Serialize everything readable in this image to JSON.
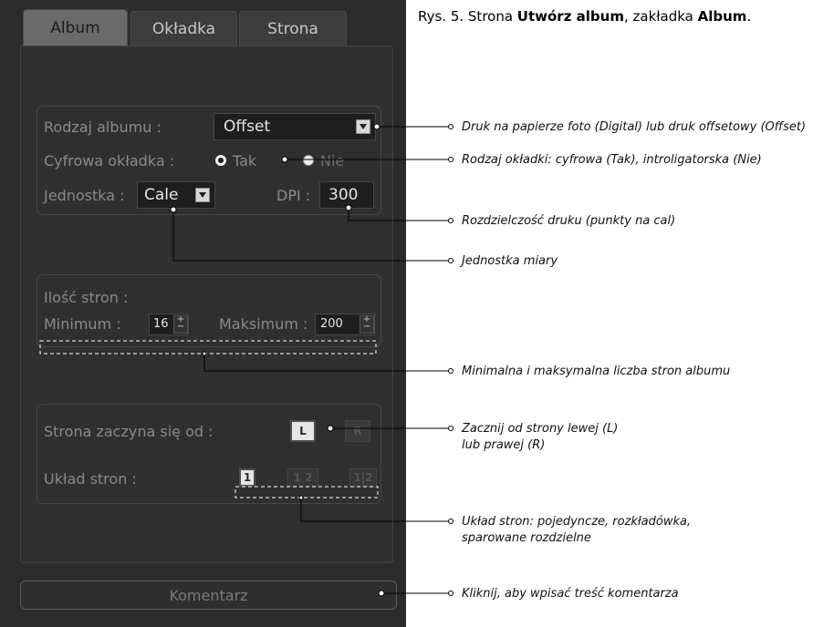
{
  "tabs": [
    {
      "label": "Album",
      "active": true
    },
    {
      "label": "Okładka",
      "active": false
    },
    {
      "label": "Strona",
      "active": false
    }
  ],
  "album_group": {
    "type_label": "Rodzaj albumu :",
    "type_value": "Offset",
    "cover_label": "Cyfrowa okładka :",
    "cover_options": [
      "Tak",
      "Nie"
    ],
    "cover_selected": "Tak",
    "unit_label": "Jednostka :",
    "unit_value": "Cale",
    "dpi_label": "DPI :",
    "dpi_value": "300"
  },
  "pages_group": {
    "title": "Ilość stron :",
    "min_label": "Minimum :",
    "min_value": "16",
    "max_label": "Maksimum :",
    "max_value": "200"
  },
  "layout_group": {
    "start_label": "Strona zaczyna się od :",
    "start_left": "L",
    "start_right": "R",
    "layout_label": "Układ stron :",
    "layout_single": "1",
    "layout_spread": "1 2",
    "layout_paired": "1|2"
  },
  "comment_button": "Komentarz",
  "caption": {
    "prefix": "Rys. 5. Strona ",
    "bold1": "Utwórz album",
    "mid": ", zakładka ",
    "bold2": "Album",
    "suffix": "."
  },
  "notes": {
    "album_type": "Druk na papierze foto (Digital) lub druk offsetowy (Offset)",
    "cover_type": "Rodzaj okładki: cyfrowa (Tak), introligatorska (Nie)",
    "resolution": "Rozdzielczość druku (punkty na cal)",
    "unit": "Jednostka miary",
    "page_count": "Minimalna i maksymalna liczba stron albumu",
    "start_line1": "Zacznij od strony lewej (L)",
    "start_line2": "lub prawej (R)",
    "layout_line1": "Układ stron: pojedyncze, rozkładówka,",
    "layout_line2": "sparowane rozdzielne",
    "comment": "Kliknij, aby wpisać treść komentarza"
  },
  "colors": {
    "panel_bg": "#2b2b2b",
    "active_tab": "#6a6a6a",
    "label_text": "#8a8a8a",
    "value_text": "#e6e6e6"
  },
  "icons": [
    "dropdown-arrow-icon",
    "radio-selected-icon",
    "radio-unselected-icon",
    "spinner-icon",
    "page-left-icon",
    "page-right-icon"
  ]
}
